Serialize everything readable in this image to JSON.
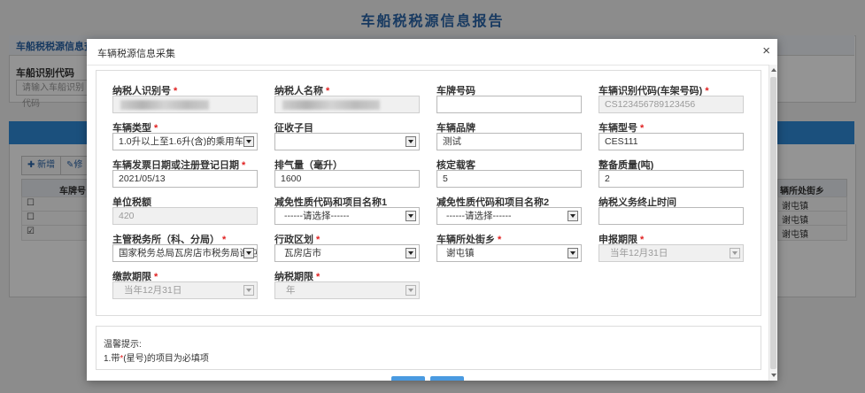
{
  "background": {
    "page_title": "车船税税源信息报告",
    "panel_title": "车船税税源信息查询",
    "search_label": "车船识别代码",
    "search_placeholder": "请输入车船识别代码",
    "toolbar": {
      "add_label": "新增",
      "edit_label": "修"
    },
    "table": {
      "col_plate": "车牌号",
      "col_town": "辆所处街乡",
      "rows": [
        {
          "checked": false,
          "town": "谢屯镇"
        },
        {
          "checked": false,
          "town": "谢屯镇"
        },
        {
          "checked": true,
          "town": "谢屯镇"
        }
      ]
    }
  },
  "modal": {
    "title": "车辆税源信息采集",
    "close_symbol": "×",
    "fields": {
      "taxpayer_id": {
        "label": "纳税人识别号",
        "required": true
      },
      "taxpayer_name": {
        "label": "纳税人名称",
        "required": true
      },
      "plate_number": {
        "label": "车牌号码",
        "required": false,
        "value": ""
      },
      "vin": {
        "label": "车辆识别代码(车架号码)",
        "required": true,
        "value": "CS123456789123456"
      },
      "vehicle_type": {
        "label": "车辆类型",
        "required": true,
        "value": "1.0升以上至1.6升(含)的乘用车"
      },
      "collect_item": {
        "label": "征收子目",
        "required": false,
        "value": ""
      },
      "brand": {
        "label": "车辆品牌",
        "required": false,
        "value": "测试"
      },
      "model": {
        "label": "车辆型号",
        "required": true,
        "value": "CES111"
      },
      "invoice_date": {
        "label": "车辆发票日期或注册登记日期",
        "required": true,
        "value": "2021/05/13"
      },
      "displacement": {
        "label": "排气量（毫升）",
        "required": false,
        "value": "1600"
      },
      "seats": {
        "label": "核定载客",
        "required": false,
        "value": "5"
      },
      "curb_weight": {
        "label": "整备质量(吨)",
        "required": false,
        "value": "2"
      },
      "unit_tax": {
        "label": "单位税额",
        "required": false,
        "value": "420"
      },
      "exempt1": {
        "label": "减免性质代码和项目名称1",
        "required": false,
        "value": "------请选择------"
      },
      "exempt2": {
        "label": "减免性质代码和项目名称2",
        "required": false,
        "value": "------请选择------"
      },
      "end_time": {
        "label": "纳税义务终止时间",
        "required": false,
        "value": ""
      },
      "tax_office": {
        "label": "主管税务所（科、分局）",
        "required": true,
        "value": "国家税务总局瓦房店市税务局谢屯"
      },
      "district": {
        "label": "行政区划",
        "required": true,
        "value": "瓦房店市"
      },
      "town": {
        "label": "车辆所处街乡",
        "required": true,
        "value": "谢屯镇"
      },
      "declare_period": {
        "label": "申报期限",
        "required": true,
        "value": "当年12月31日"
      },
      "pay_period": {
        "label": "缴款期限",
        "required": true,
        "value": "当年12月31日"
      },
      "tax_term": {
        "label": "纳税期限",
        "required": true,
        "value": "年"
      }
    },
    "tips": {
      "title": "温馨提示:",
      "line1_prefix": "1.带",
      "line1_star": "*",
      "line1_suffix": "(星号)的项目为必填项"
    }
  },
  "colors": {
    "accent": "#2f8ad8",
    "required": "#e02020",
    "title": "#2a64a8"
  }
}
